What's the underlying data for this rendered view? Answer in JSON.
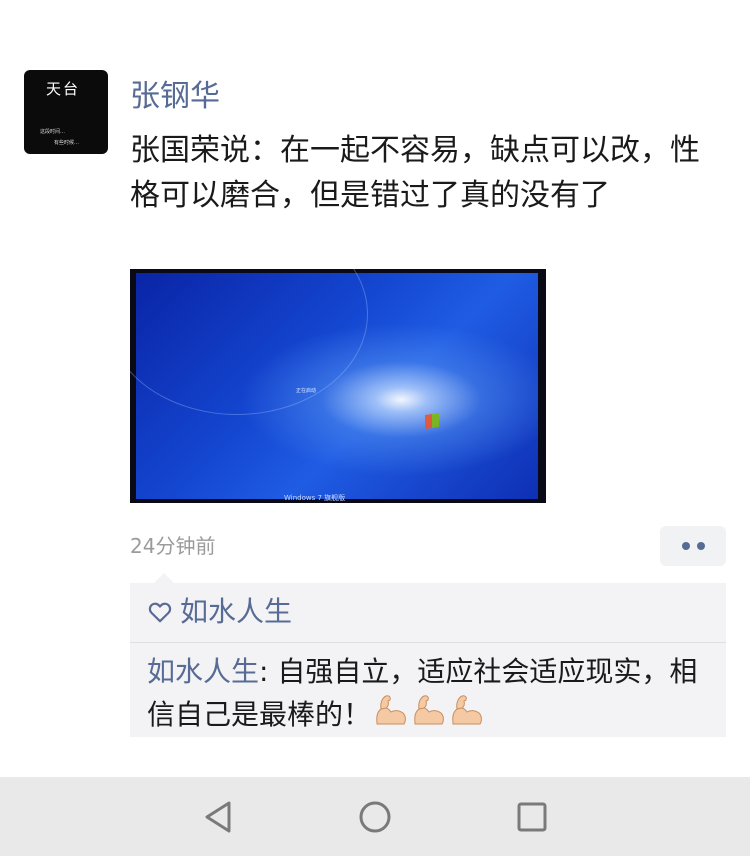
{
  "post": {
    "avatar": {
      "title": "天台",
      "caption_line1": "这段时间…",
      "caption_line2": "有些时候…"
    },
    "author": "张钢华",
    "text": "张国荣说：在一起不容易，缺点可以改，性格可以磨合，但是错过了真的没有了",
    "photo": {
      "boot_text": "正在启动",
      "brand_text": "Windows 7 旗舰版"
    },
    "timestamp": "24分钟前",
    "more_icon": "more-dots-icon"
  },
  "interactions": {
    "likes_icon": "heart-outline-icon",
    "liker": "如水人生",
    "comments": [
      {
        "author": "如水人生",
        "separator": ": ",
        "text": "自强自立，适应社会适应现实，相信自己是最棒的！",
        "emojis": [
          "flexed-biceps-icon",
          "flexed-biceps-icon",
          "flexed-biceps-icon"
        ]
      }
    ]
  },
  "navigation": {
    "back_icon": "back-triangle-icon",
    "home_icon": "home-circle-icon",
    "recent_icon": "recent-apps-square-icon"
  },
  "colors": {
    "link": "#576b95",
    "timestamp": "#9b9b9b",
    "panel": "#f3f3f5",
    "navbar": "#e9e9e9"
  }
}
